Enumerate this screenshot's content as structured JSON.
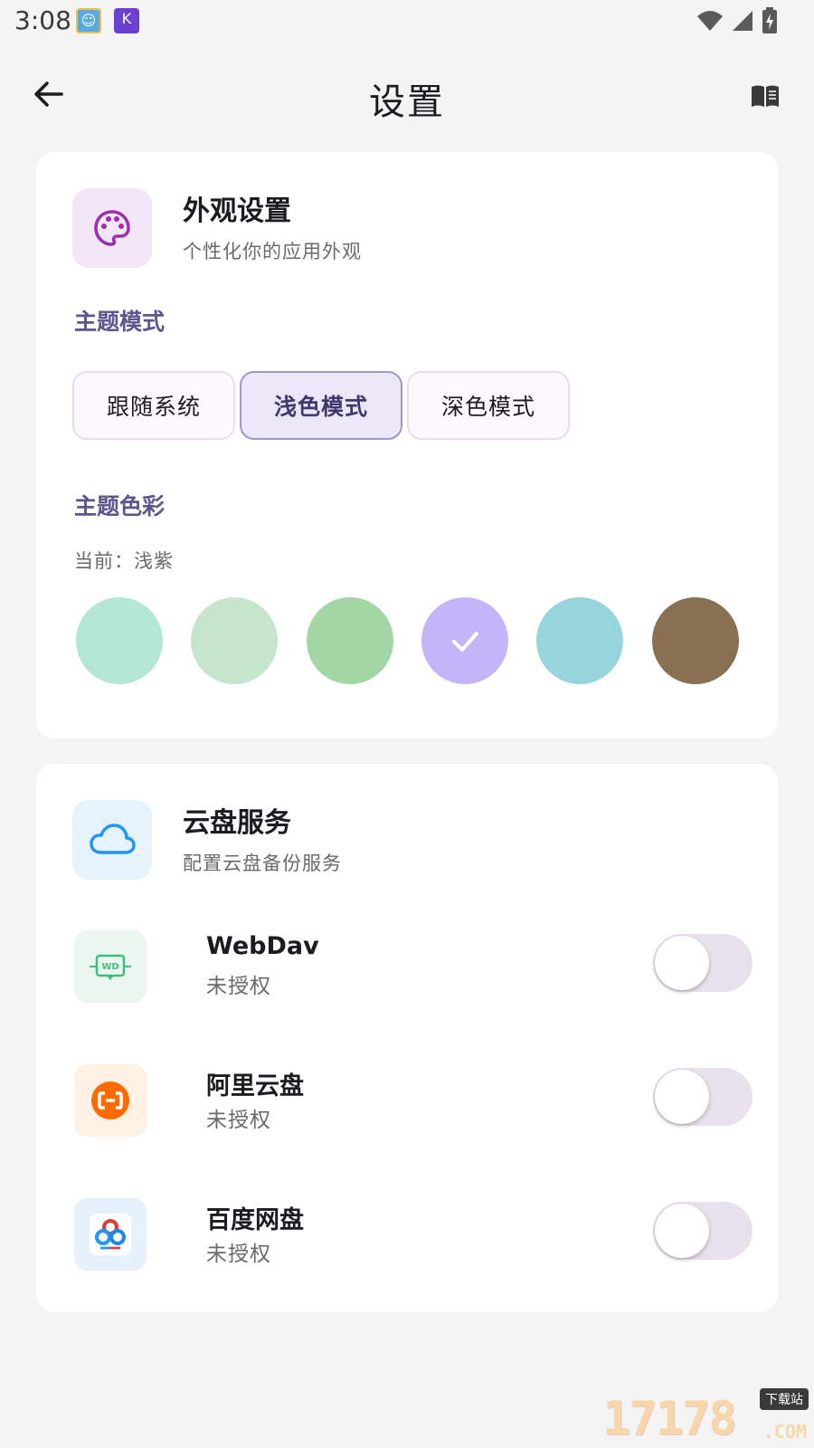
{
  "status_bar": {
    "time": "3:08",
    "icons": [
      "app-icon-1",
      "app-icon-2",
      "wifi-icon",
      "signal-icon",
      "battery-charging-icon"
    ]
  },
  "header": {
    "title": "设置",
    "back_icon": "arrow-left-icon",
    "right_icon": "book-icon"
  },
  "appearance": {
    "title": "外观设置",
    "subtitle": "个性化你的应用外观",
    "icon": "palette-icon",
    "theme_mode_label": "主题模式",
    "modes": [
      {
        "label": "跟随系统",
        "selected": false
      },
      {
        "label": "浅色模式",
        "selected": true
      },
      {
        "label": "深色模式",
        "selected": false
      }
    ],
    "theme_color_label": "主题色彩",
    "current_color_text": "当前：浅紫",
    "swatches": [
      {
        "color": "#b3e6d4",
        "selected": false
      },
      {
        "color": "#c6e6cb",
        "selected": false
      },
      {
        "color": "#a3d6a5",
        "selected": false
      },
      {
        "color": "#c4b5fb",
        "selected": true
      },
      {
        "color": "#96d5dc",
        "selected": false
      },
      {
        "color": "#8a7053",
        "selected": false
      }
    ]
  },
  "cloud": {
    "title": "云盘服务",
    "subtitle": "配置云盘备份服务",
    "icon": "cloud-icon",
    "services": [
      {
        "name": "WebDav",
        "status": "未授权",
        "icon": "webdav-icon",
        "enabled": false
      },
      {
        "name": "阿里云盘",
        "status": "未授权",
        "icon": "aliyun-icon",
        "enabled": false
      },
      {
        "name": "百度网盘",
        "status": "未授权",
        "icon": "baidu-icon",
        "enabled": false
      }
    ]
  },
  "watermark": {
    "text": "17178",
    "tag": "下载站",
    "suffix": ".COM"
  },
  "colors": {
    "accent": "#5c5590",
    "card_bg": "#ffffff",
    "page_bg": "#f4f4f4"
  }
}
